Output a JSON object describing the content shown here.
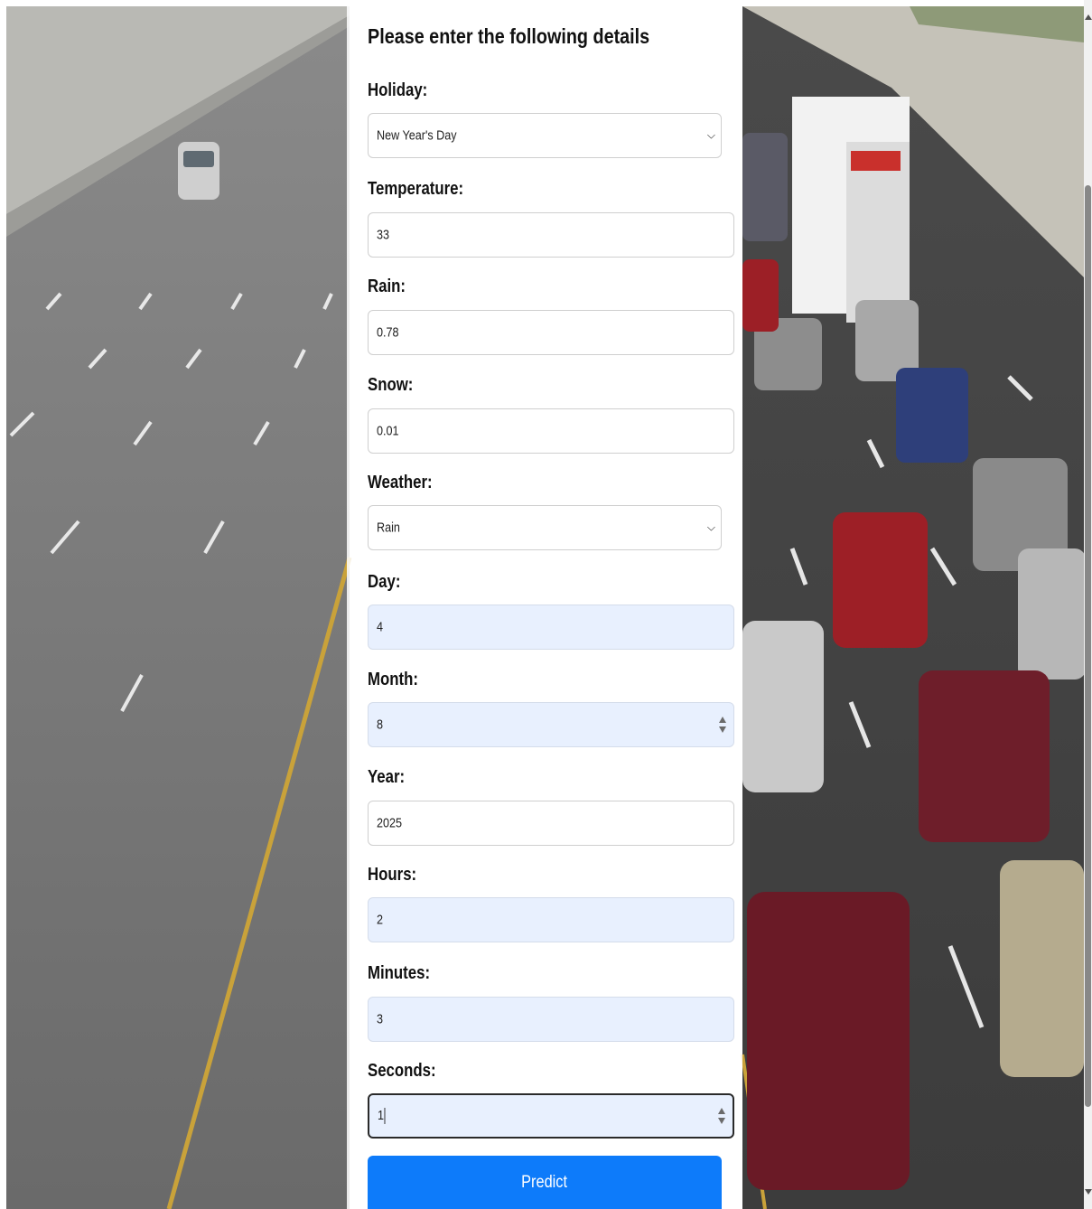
{
  "form": {
    "title": "Please enter the following details",
    "fields": {
      "holiday": {
        "label": "Holiday:",
        "value": "New Year's Day"
      },
      "temperature": {
        "label": "Temperature:",
        "value": "33"
      },
      "rain": {
        "label": "Rain:",
        "value": "0.78"
      },
      "snow": {
        "label": "Snow:",
        "value": "0.01"
      },
      "weather": {
        "label": "Weather:",
        "value": "Rain"
      },
      "day": {
        "label": "Day:",
        "value": "4"
      },
      "month": {
        "label": "Month:",
        "value": "8"
      },
      "year": {
        "label": "Year:",
        "value": "2025"
      },
      "hours": {
        "label": "Hours:",
        "value": "2"
      },
      "minutes": {
        "label": "Minutes:",
        "value": "3"
      },
      "seconds": {
        "label": "Seconds:",
        "value": "1"
      }
    },
    "submit_label": "Predict"
  },
  "colors": {
    "button": "#0d7bfa",
    "autofill": "#e8f0fe",
    "road": "#6f6f6f",
    "lane_yellow": "#c9a23a"
  },
  "icons": {
    "select": "chevron-down-icon",
    "number": "spinner-icon"
  }
}
